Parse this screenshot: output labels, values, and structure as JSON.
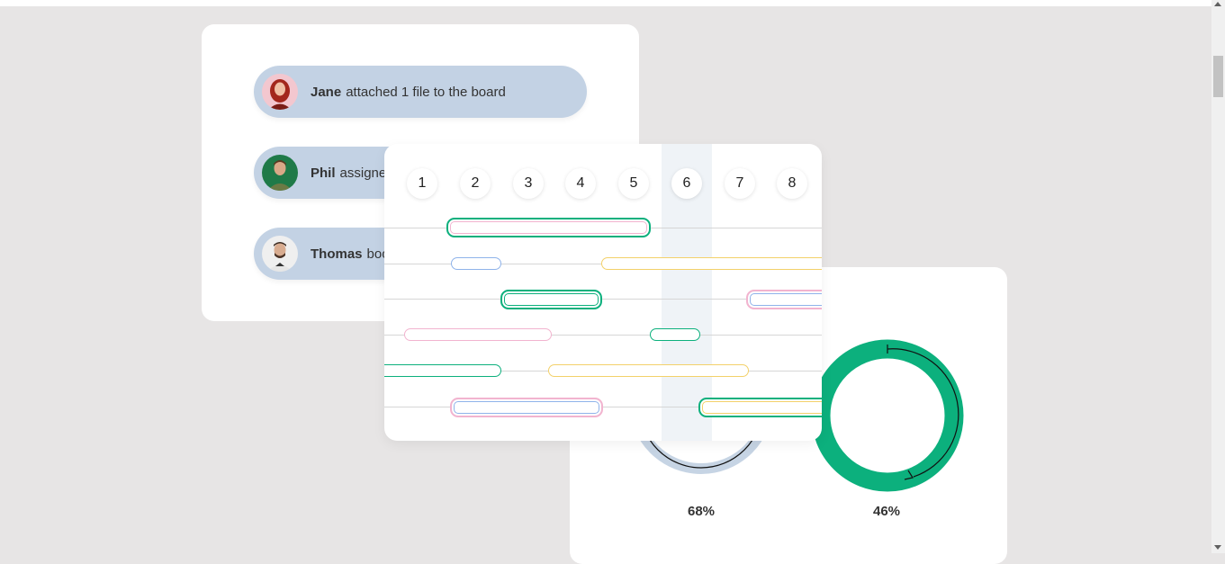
{
  "activity": {
    "items": [
      {
        "name": "Jane",
        "text": "attached 1 file to the board"
      },
      {
        "name": "Phil",
        "text": "assigned"
      },
      {
        "name": "Thomas",
        "text": "boo"
      }
    ]
  },
  "gantt": {
    "days": [
      "1",
      "2",
      "3",
      "4",
      "5",
      "6",
      "7",
      "8"
    ],
    "highlighted_day": "6"
  },
  "progress": {
    "left_percent": "68%",
    "right_percent": "46%"
  },
  "colors": {
    "green": "#0cb07d",
    "yellow": "#f3d16a",
    "blue": "#8fb3ea",
    "pink": "#f2b4cf",
    "pill_bg": "#c3d2e4",
    "ring_light": "#c6d4e4"
  }
}
